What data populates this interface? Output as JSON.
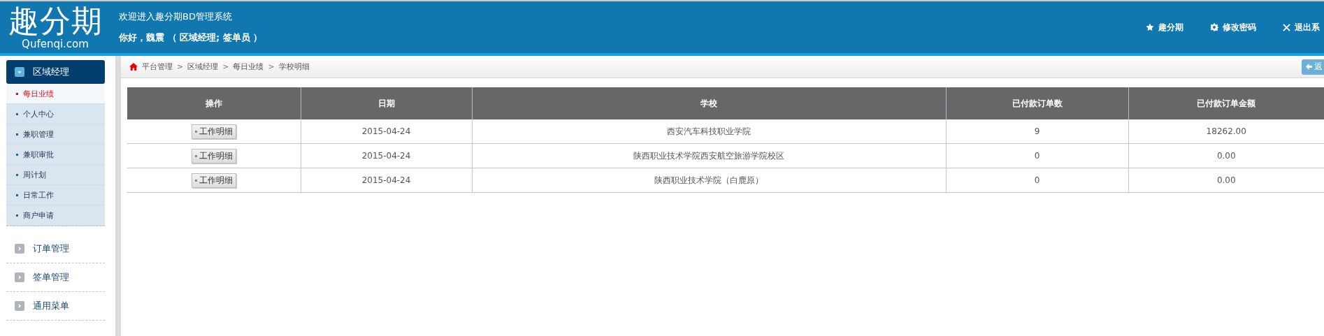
{
  "header": {
    "logo": {
      "title": "趣分期",
      "subtitle": "Qufenqi.com"
    },
    "welcome": "欢迎进入趣分期BD管理系统",
    "greeting": "你好，魏震 （ 区域经理; 签单员 ）",
    "nav": [
      {
        "kind": "star",
        "label": "趣分期"
      },
      {
        "kind": "gear",
        "label": "修改密码"
      },
      {
        "kind": "close",
        "label": "退出系"
      }
    ]
  },
  "sidebar": {
    "groups": [
      {
        "label": "区域经理",
        "expanded": true,
        "children": [
          {
            "label": "每日业绩",
            "selected": true
          },
          {
            "label": "个人中心",
            "selected": false
          },
          {
            "label": "兼职管理",
            "selected": false
          },
          {
            "label": "兼职审批",
            "selected": false
          },
          {
            "label": "周计划",
            "selected": false
          },
          {
            "label": "日常工作",
            "selected": false
          },
          {
            "label": "商户申请",
            "selected": false
          }
        ]
      },
      {
        "label": "订单管理",
        "expanded": false
      },
      {
        "label": "签单管理",
        "expanded": false
      },
      {
        "label": "通用菜单",
        "expanded": false
      }
    ]
  },
  "breadcrumb": [
    "平台管理",
    "区域经理",
    "每日业绩",
    "学校明细"
  ],
  "breadcrumb_separator": ">",
  "back_button": "返",
  "table": {
    "columns": [
      "操作",
      "日期",
      "学校",
      "已付款订单数",
      "已付款订单金额"
    ],
    "rows": [
      {
        "action": "工作明细",
        "date": "2015-04-24",
        "school": "西安汽车科技职业学院",
        "count": "9",
        "amount": "18262.00"
      },
      {
        "action": "工作明细",
        "date": "2015-04-24",
        "school": "陕西职业技术学院西安航空旅游学院校区",
        "count": "0",
        "amount": "0.00"
      },
      {
        "action": "工作明细",
        "date": "2015-04-24",
        "school": "陕西职业技术学院（白鹿原）",
        "count": "0",
        "amount": "0.00"
      }
    ]
  }
}
